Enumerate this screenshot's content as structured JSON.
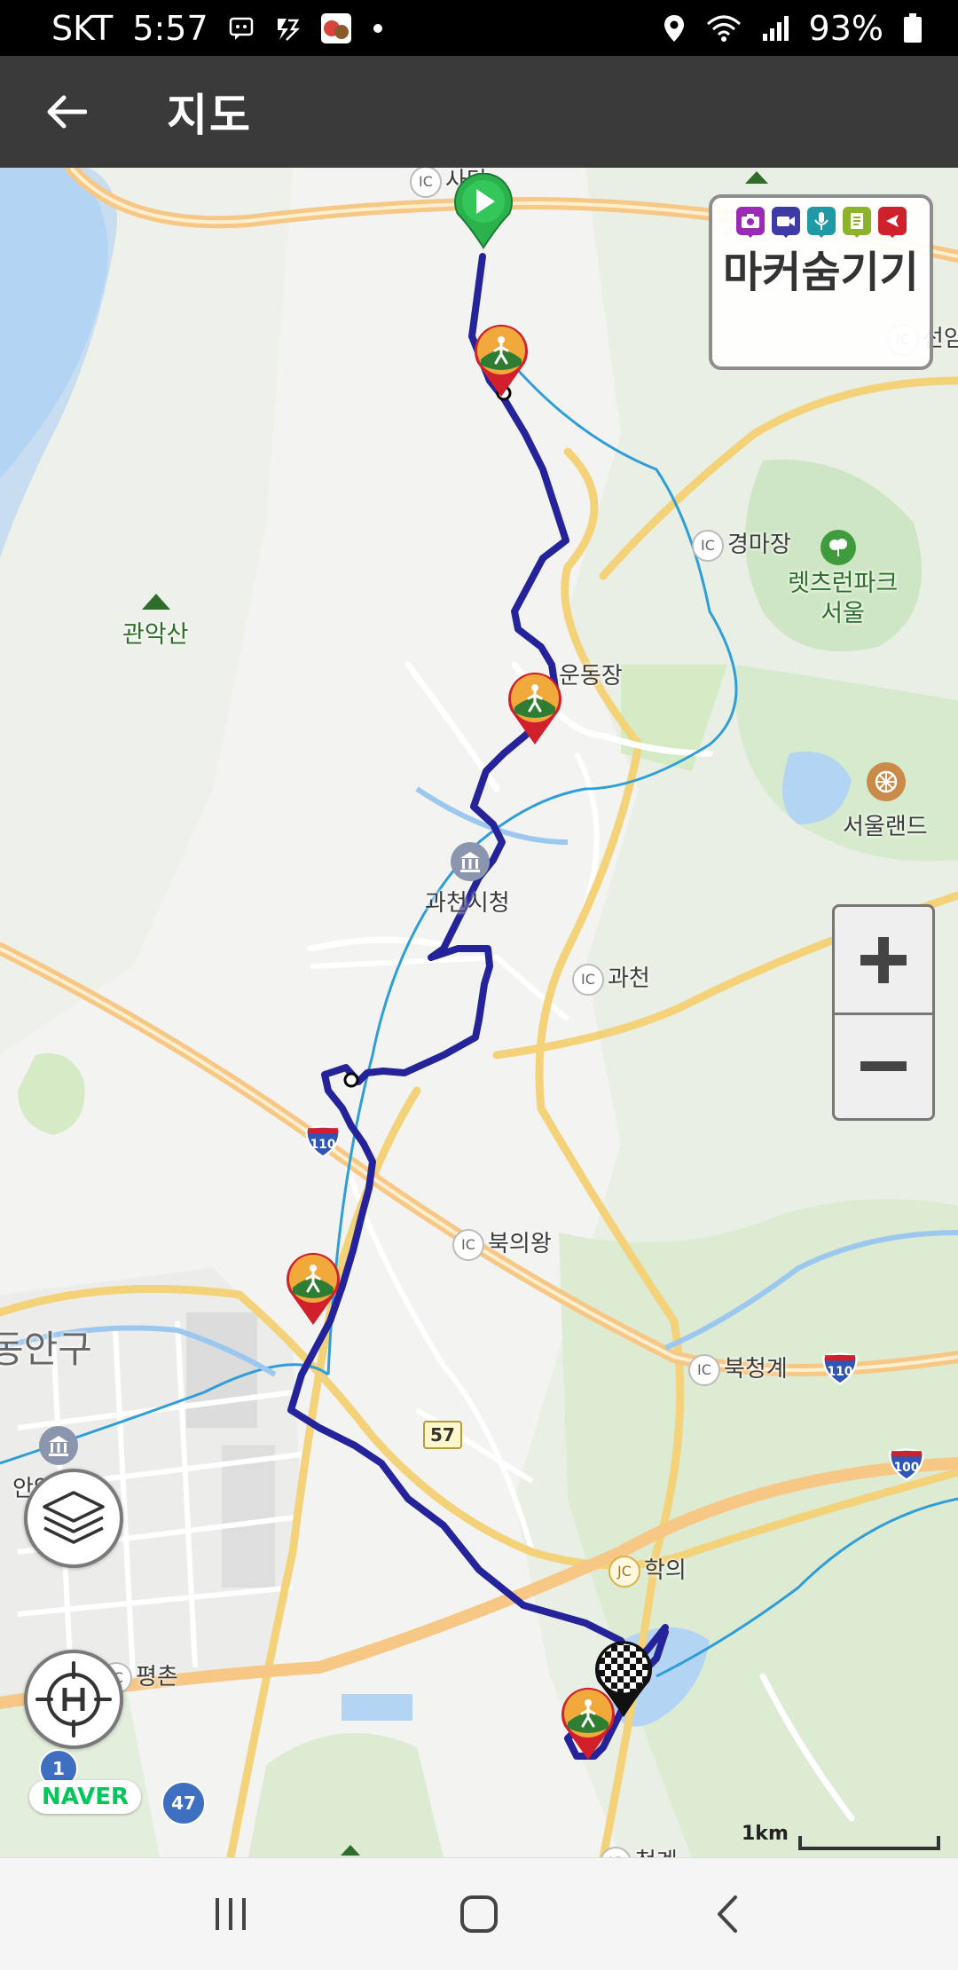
{
  "status": {
    "carrier": "SKT",
    "time": "5:57",
    "battery": "93%",
    "icons_left": [
      "chat-icon",
      "shortcut-icon",
      "app-notification-icon",
      "dot-icon"
    ],
    "icons_right": [
      "location-icon",
      "wifi-icon",
      "signal-icon",
      "battery-icon"
    ]
  },
  "header": {
    "title": "지도",
    "back_icon": "arrow-left-icon"
  },
  "marker_panel": {
    "label": "마커숨기기",
    "icons": [
      {
        "name": "camera-marker-icon",
        "color": "#9b2bb5"
      },
      {
        "name": "video-marker-icon",
        "color": "#3e3ba7"
      },
      {
        "name": "voice-marker-icon",
        "color": "#1f9aa5"
      },
      {
        "name": "memo-marker-icon",
        "color": "#8db32b"
      },
      {
        "name": "flag-marker-icon",
        "color": "#d0202c"
      }
    ]
  },
  "map_labels": {
    "sadang": "사당",
    "gwanaksan": "관악산",
    "gyeongmajang": "경마장",
    "letsrun_park": "렛츠런파크\n서울",
    "undongjang": "운동장",
    "seoulland": "서울랜드",
    "gwacheon_cityhall": "과천시청",
    "gwacheon": "과천",
    "bukuiwang": "북의왕",
    "dongan_gu": "동안구",
    "bukcheonggye": "북청계",
    "anyang_cityhall": "안양시청",
    "hakui": "학의",
    "pyeongchon": "평촌",
    "seonam": "선암",
    "bottom_cut": "청계"
  },
  "badges": {
    "ic": "IC",
    "jc": "JC"
  },
  "routes": {
    "r110_a": "110",
    "r110_b": "110",
    "r100": "100",
    "r57": "57",
    "r1": "1",
    "r47": "47"
  },
  "zoom": {
    "in_label": "+",
    "out_label": "−"
  },
  "map_tools": {
    "layers_icon": "layers-icon",
    "home_icon": "home-target-icon"
  },
  "naver_logo": "NAVER",
  "scale": "1km",
  "nav": {
    "recent_icon": "recent-apps-icon",
    "home_icon": "home-icon",
    "back_icon": "back-icon"
  },
  "colors": {
    "route": "#25239a",
    "water": "#b3d4f2",
    "park": "#d5e9cc",
    "highway": "#f6c785",
    "road": "#fce8a0"
  }
}
